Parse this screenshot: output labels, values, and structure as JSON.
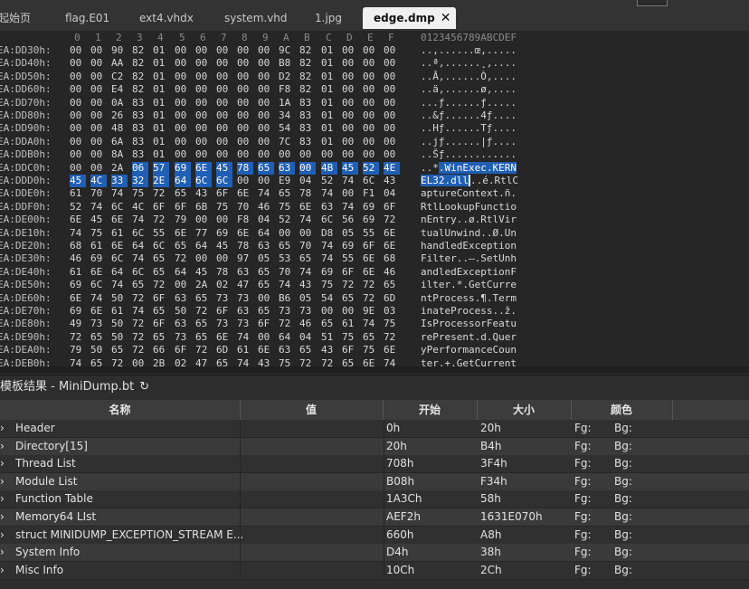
{
  "tabs": [
    {
      "label": "起始页",
      "active": false
    },
    {
      "label": "flag.E01",
      "active": false
    },
    {
      "label": "ext4.vhdx",
      "active": false
    },
    {
      "label": "system.vhd",
      "active": false
    },
    {
      "label": "1.jpg",
      "active": false
    },
    {
      "label": "edge.dmp",
      "active": true
    }
  ],
  "close_glyph": "✕",
  "hex": {
    "column_labels": [
      "0",
      "1",
      "2",
      "3",
      "4",
      "5",
      "6",
      "7",
      "8",
      "9",
      "A",
      "B",
      "C",
      "D",
      "E",
      "F"
    ],
    "ascii_header": "0123456789ABCDEF",
    "rows": [
      {
        "addr": "EA:DD30h:",
        "bytes": [
          "00",
          "00",
          "90",
          "82",
          "01",
          "00",
          "00",
          "00",
          "00",
          "00",
          "9C",
          "82",
          "01",
          "00",
          "00",
          "00"
        ],
        "ascii": "..,......œ,....."
      },
      {
        "addr": "EA:DD40h:",
        "bytes": [
          "00",
          "00",
          "AA",
          "82",
          "01",
          "00",
          "00",
          "00",
          "00",
          "00",
          "B8",
          "82",
          "01",
          "00",
          "00",
          "00"
        ],
        "ascii": "..ª,......¸,...."
      },
      {
        "addr": "EA:DD50h:",
        "bytes": [
          "00",
          "00",
          "C2",
          "82",
          "01",
          "00",
          "00",
          "00",
          "00",
          "00",
          "D2",
          "82",
          "01",
          "00",
          "00",
          "00"
        ],
        "ascii": "..Â,......Ò,...."
      },
      {
        "addr": "EA:DD60h:",
        "bytes": [
          "00",
          "00",
          "E4",
          "82",
          "01",
          "00",
          "00",
          "00",
          "00",
          "00",
          "F8",
          "82",
          "01",
          "00",
          "00",
          "00"
        ],
        "ascii": "..ä,......ø,...."
      },
      {
        "addr": "EA:DD70h:",
        "bytes": [
          "00",
          "00",
          "0A",
          "83",
          "01",
          "00",
          "00",
          "00",
          "00",
          "00",
          "1A",
          "83",
          "01",
          "00",
          "00",
          "00"
        ],
        "ascii": "...ƒ......ƒ....."
      },
      {
        "addr": "EA:DD80h:",
        "bytes": [
          "00",
          "00",
          "26",
          "83",
          "01",
          "00",
          "00",
          "00",
          "00",
          "00",
          "34",
          "83",
          "01",
          "00",
          "00",
          "00"
        ],
        "ascii": "..&ƒ......4ƒ...."
      },
      {
        "addr": "EA:DD90h:",
        "bytes": [
          "00",
          "00",
          "48",
          "83",
          "01",
          "00",
          "00",
          "00",
          "00",
          "00",
          "54",
          "83",
          "01",
          "00",
          "00",
          "00"
        ],
        "ascii": "..Hƒ......Tƒ...."
      },
      {
        "addr": "EA:DDA0h:",
        "bytes": [
          "00",
          "00",
          "6A",
          "83",
          "01",
          "00",
          "00",
          "00",
          "00",
          "00",
          "7C",
          "83",
          "01",
          "00",
          "00",
          "00"
        ],
        "ascii": "..jƒ......|ƒ...."
      },
      {
        "addr": "EA:DDB0h:",
        "bytes": [
          "00",
          "00",
          "8A",
          "83",
          "01",
          "00",
          "00",
          "00",
          "00",
          "00",
          "00",
          "00",
          "00",
          "00",
          "00",
          "00"
        ],
        "ascii": "..Šƒ............"
      },
      {
        "addr": "EA:DDC0h:",
        "bytes": [
          "00",
          "00",
          "2A",
          "06",
          "57",
          "69",
          "6E",
          "45",
          "78",
          "65",
          "63",
          "00",
          "4B",
          "45",
          "52",
          "4E"
        ],
        "ascii": "..*.WinExec.KERN"
      },
      {
        "addr": "EA:DDD0h:",
        "bytes": [
          "45",
          "4C",
          "33",
          "32",
          "2E",
          "64",
          "6C",
          "6C",
          "00",
          "00",
          "E9",
          "04",
          "52",
          "74",
          "6C",
          "43"
        ],
        "ascii": "EL32.dll..é.RtlC"
      },
      {
        "addr": "EA:DDE0h:",
        "bytes": [
          "61",
          "70",
          "74",
          "75",
          "72",
          "65",
          "43",
          "6F",
          "6E",
          "74",
          "65",
          "78",
          "74",
          "00",
          "F1",
          "04"
        ],
        "ascii": "aptureContext.ñ."
      },
      {
        "addr": "EA:DDF0h:",
        "bytes": [
          "52",
          "74",
          "6C",
          "4C",
          "6F",
          "6F",
          "6B",
          "75",
          "70",
          "46",
          "75",
          "6E",
          "63",
          "74",
          "69",
          "6F"
        ],
        "ascii": "RtlLookupFunctio"
      },
      {
        "addr": "EA:DE00h:",
        "bytes": [
          "6E",
          "45",
          "6E",
          "74",
          "72",
          "79",
          "00",
          "00",
          "F8",
          "04",
          "52",
          "74",
          "6C",
          "56",
          "69",
          "72"
        ],
        "ascii": "nEntry..ø.RtlVir"
      },
      {
        "addr": "EA:DE10h:",
        "bytes": [
          "74",
          "75",
          "61",
          "6C",
          "55",
          "6E",
          "77",
          "69",
          "6E",
          "64",
          "00",
          "00",
          "D8",
          "05",
          "55",
          "6E"
        ],
        "ascii": "tualUnwind..Ø.Un"
      },
      {
        "addr": "EA:DE20h:",
        "bytes": [
          "68",
          "61",
          "6E",
          "64",
          "6C",
          "65",
          "64",
          "45",
          "78",
          "63",
          "65",
          "70",
          "74",
          "69",
          "6F",
          "6E"
        ],
        "ascii": "handledException"
      },
      {
        "addr": "EA:DE30h:",
        "bytes": [
          "46",
          "69",
          "6C",
          "74",
          "65",
          "72",
          "00",
          "00",
          "97",
          "05",
          "53",
          "65",
          "74",
          "55",
          "6E",
          "68"
        ],
        "ascii": "Filter..—.SetUnh"
      },
      {
        "addr": "EA:DE40h:",
        "bytes": [
          "61",
          "6E",
          "64",
          "6C",
          "65",
          "64",
          "45",
          "78",
          "63",
          "65",
          "70",
          "74",
          "69",
          "6F",
          "6E",
          "46"
        ],
        "ascii": "andledExceptionF"
      },
      {
        "addr": "EA:DE50h:",
        "bytes": [
          "69",
          "6C",
          "74",
          "65",
          "72",
          "00",
          "2A",
          "02",
          "47",
          "65",
          "74",
          "43",
          "75",
          "72",
          "72",
          "65"
        ],
        "ascii": "ilter.*.GetCurre"
      },
      {
        "addr": "EA:DE60h:",
        "bytes": [
          "6E",
          "74",
          "50",
          "72",
          "6F",
          "63",
          "65",
          "73",
          "73",
          "00",
          "B6",
          "05",
          "54",
          "65",
          "72",
          "6D"
        ],
        "ascii": "ntProcess.¶.Term"
      },
      {
        "addr": "EA:DE70h:",
        "bytes": [
          "69",
          "6E",
          "61",
          "74",
          "65",
          "50",
          "72",
          "6F",
          "63",
          "65",
          "73",
          "73",
          "00",
          "00",
          "9E",
          "03"
        ],
        "ascii": "inateProcess..ž."
      },
      {
        "addr": "EA:DE80h:",
        "bytes": [
          "49",
          "73",
          "50",
          "72",
          "6F",
          "63",
          "65",
          "73",
          "73",
          "6F",
          "72",
          "46",
          "65",
          "61",
          "74",
          "75"
        ],
        "ascii": "IsProcessorFeatu"
      },
      {
        "addr": "EA:DE90h:",
        "bytes": [
          "72",
          "65",
          "50",
          "72",
          "65",
          "73",
          "65",
          "6E",
          "74",
          "00",
          "64",
          "04",
          "51",
          "75",
          "65",
          "72"
        ],
        "ascii": "rePresent.d.Quer"
      },
      {
        "addr": "EA:DEA0h:",
        "bytes": [
          "79",
          "50",
          "65",
          "72",
          "66",
          "6F",
          "72",
          "6D",
          "61",
          "6E",
          "63",
          "65",
          "43",
          "6F",
          "75",
          "6E"
        ],
        "ascii": "yPerformanceCoun"
      },
      {
        "addr": "EA:DEB0h:",
        "bytes": [
          "74",
          "65",
          "72",
          "00",
          "2B",
          "02",
          "47",
          "65",
          "74",
          "43",
          "75",
          "72",
          "72",
          "65",
          "6E",
          "74"
        ],
        "ascii": "ter.+.GetCurrent"
      }
    ]
  },
  "results": {
    "title": "模板结果 - MiniDump.bt",
    "refresh_glyph": "↻",
    "columns": [
      "名称",
      "值",
      "开始",
      "大小",
      "颜色"
    ],
    "fg_label": "Fg:",
    "bg_label": "Bg:",
    "rows": [
      {
        "name": "Header",
        "value": "",
        "start": "0h",
        "size": "20h"
      },
      {
        "name": "Directory[15]",
        "value": "",
        "start": "20h",
        "size": "B4h"
      },
      {
        "name": "Thread List",
        "value": "",
        "start": "708h",
        "size": "3F4h"
      },
      {
        "name": "Module List",
        "value": "",
        "start": "B08h",
        "size": "F34h"
      },
      {
        "name": "Function Table",
        "value": "",
        "start": "1A3Ch",
        "size": "58h"
      },
      {
        "name": "Memory64 LIst",
        "value": "",
        "start": "AEF2h",
        "size": "1631E070h"
      },
      {
        "name": "struct MINIDUMP_EXCEPTION_STREAM E...",
        "value": "",
        "start": "660h",
        "size": "A8h"
      },
      {
        "name": "System Info",
        "value": "",
        "start": "D4h",
        "size": "38h"
      },
      {
        "name": "Misc Info",
        "value": "",
        "start": "10Ch",
        "size": "2Ch"
      }
    ]
  }
}
